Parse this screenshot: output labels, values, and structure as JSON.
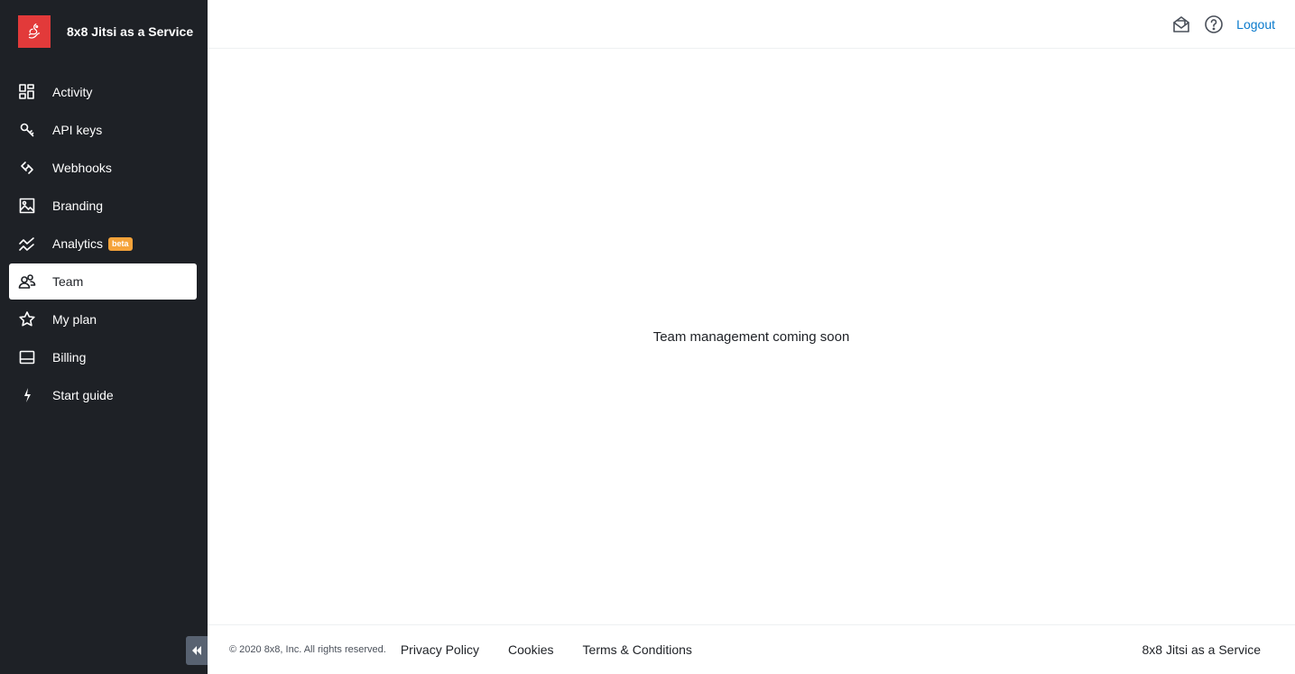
{
  "brand": {
    "name": "8x8 Jitsi as a Service",
    "logo_color": "#e23a3a"
  },
  "sidebar": {
    "items": [
      {
        "label": "Activity",
        "icon": "dashboard-grid-icon",
        "active": false
      },
      {
        "label": "API keys",
        "icon": "key-icon",
        "active": false
      },
      {
        "label": "Webhooks",
        "icon": "link-icon",
        "active": false
      },
      {
        "label": "Branding",
        "icon": "image-icon",
        "active": false
      },
      {
        "label": "Analytics",
        "icon": "trend-chart-icon",
        "active": false,
        "badge": "beta"
      },
      {
        "label": "Team",
        "icon": "team-icon",
        "active": true
      },
      {
        "label": "My plan",
        "icon": "star-icon",
        "active": false
      },
      {
        "label": "Billing",
        "icon": "card-icon",
        "active": false
      },
      {
        "label": "Start guide",
        "icon": "lightning-icon",
        "active": false
      }
    ]
  },
  "topbar": {
    "logout_label": "Logout",
    "icons": [
      "mail-open-icon",
      "help-circle-icon"
    ]
  },
  "main": {
    "message": "Team management coming soon"
  },
  "footer": {
    "copyright": "© 2020 8x8, Inc. All rights reserved.",
    "links": [
      "Privacy Policy",
      "Cookies",
      "Terms & Conditions"
    ],
    "brand": "8x8 Jitsi as a Service"
  },
  "colors": {
    "sidebar_bg": "#1e2126",
    "accent_link": "#0a7acc",
    "badge_bg": "#f5a33a"
  }
}
